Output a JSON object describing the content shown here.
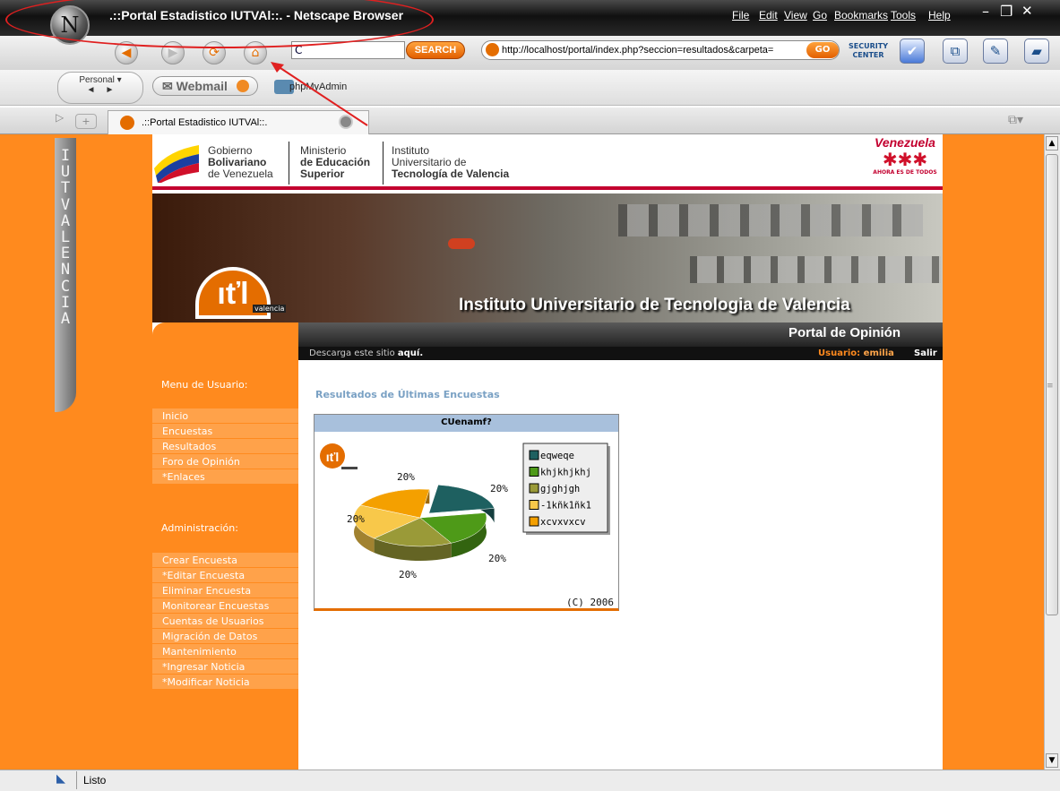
{
  "window": {
    "title": ".::Portal Estadistico IUTVAl::. - Netscape Browser",
    "menu": [
      "File",
      "Edit",
      "View",
      "Go",
      "Bookmarks",
      "Tools",
      "Help"
    ]
  },
  "toolbar": {
    "search_value": "C",
    "search_button": "SEARCH",
    "url": "http://localhost/portal/index.php?seccion=resultados&carpeta=",
    "go": "GO",
    "security_center": "SECURITY\nCENTER"
  },
  "personal_bar": {
    "personal": "Personal",
    "webmail": "Webmail",
    "phpmyadmin": "phpMyAdmin"
  },
  "tab": {
    "label": ".::Portal Estadistico IUTVAl::."
  },
  "side_text": "IUTVALENCIA",
  "gov": {
    "col1": [
      "Gobierno",
      "Bolivariano",
      "de Venezuela"
    ],
    "col2": [
      "Ministerio",
      "de Educación",
      "Superior"
    ],
    "col3": [
      "Instituto",
      "Universitario de",
      "Tecnología de Valencia"
    ],
    "vzla": "Venezuela",
    "vzla_sub": "AHORA ES DE TODOS"
  },
  "banner": {
    "text": "Instituto Universitario de Tecnologia de Valencia",
    "portal": "Portal de Opinión",
    "logo_sub": "valencia"
  },
  "topbar": {
    "download": "Descarga este sitio ",
    "download_link": "aquí.",
    "user_label": "Usuario: ",
    "user_name": "emilia",
    "logout": "Salir"
  },
  "menu": {
    "user_head": "Menu de Usuario:",
    "user_items": [
      "Inicio",
      "Encuestas",
      "Resultados",
      "Foro de Opinión",
      "*Enlaces"
    ],
    "admin_head": "Administración:",
    "admin_items": [
      "Crear Encuesta",
      "*Editar Encuesta",
      "Eliminar Encuesta",
      "Monitorear Encuestas",
      "Cuentas de Usuarios",
      "Migración de Datos",
      "Mantenimiento",
      "*Ingresar Noticia",
      "*Modificar Noticia"
    ]
  },
  "main": {
    "title": "Resultados de Últimas Encuestas",
    "copyright": "(C) 2006"
  },
  "chart_data": {
    "type": "pie",
    "title": "CUenamf?",
    "categories": [
      "eqweqe",
      "khjkhjkhj",
      "gjghjgh",
      "-1kñk1ñk1",
      "xcvxvxcv"
    ],
    "values": [
      20,
      20,
      20,
      20,
      20
    ],
    "value_labels": [
      "20%",
      "20%",
      "20%",
      "20%",
      "20%"
    ],
    "colors": [
      "#1e6060",
      "#4e9a18",
      "#9a9a38",
      "#f8c84a",
      "#f4a000"
    ],
    "legend_position": "right"
  },
  "status": {
    "text": "Listo"
  }
}
